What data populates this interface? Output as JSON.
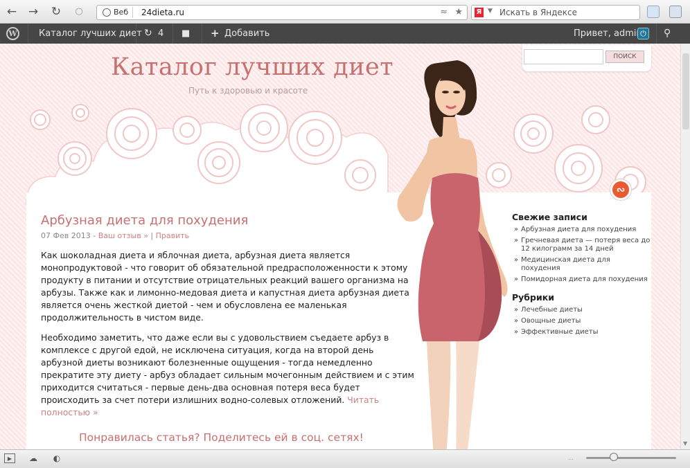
{
  "browser": {
    "site_ident": "Веб",
    "url": "24dieta.ru",
    "search_placeholder": "Искать в Яндексе",
    "yandex_logo": "Я"
  },
  "admin_bar": {
    "site_name": "Каталог лучших диет",
    "updates_count": "4",
    "add_new": "Добавить",
    "greeting": "Привет, admin"
  },
  "header": {
    "title": "Каталог лучших диет",
    "tagline": "Путь к здоровью и красоте",
    "search_button": "ПОИСК"
  },
  "post": {
    "title": "Арбузная диета для похудения",
    "date": "07 Фев 2013",
    "separator1": " - ",
    "reviews_link": "Ваш отзыв »",
    "separator2": " | ",
    "edit_link": "Править",
    "paragraph1": "Как шоколадная диета и яблочная диета, арбузная диета является монопродуктовой - что говорит об обязательной предрасположенности к этому продукту в питании и отсутствие отрицательных реакций вашего организма на арбузы. Также как и лимонно-медовая диета и капустная диета арбузная диета является очень жесткой диетой - чем и обусловлена ее маленькая продолжительность в чистом виде.",
    "paragraph2": "Необходимо заметить, что даже если вы с удовольствием съедаете арбуз в комплексе с другой едой, не исключена ситуация, когда на второй день арбузной диеты возникают болезненные ощущения - тогда немедленно прекратите эту диету - арбуз обладает сильным мочегонным действием и с этим приходится считаться - первые день-два основная потеря веса будет происходить за счет потери излишних водно-солевых отложений.",
    "read_more": "Читать полностью »",
    "share_text": "Понравилась статья? Поделитесь ей в соц. сетях!"
  },
  "sidebar": {
    "recent_heading": "Свежие записи",
    "recent": [
      {
        "label": "Арбузная диета для похудения"
      },
      {
        "label": "Гречневая диета — потеря веса до 12 килограмм за 14 дней"
      },
      {
        "label": "Медицинская диета для похудения"
      },
      {
        "label": "Помидорная диета для похудения"
      }
    ],
    "categories_heading": "Рубрики",
    "categories": [
      {
        "label": "Лечебные диеты"
      },
      {
        "label": "Овощные диеты"
      },
      {
        "label": "Эффективные диеты"
      }
    ]
  },
  "colors": {
    "accent": "#c77070",
    "link": "#d28080",
    "admin_bar": "#464646",
    "rss": "#e95b33"
  },
  "icons": {
    "back": "back-arrow-icon",
    "forward": "forward-arrow-icon",
    "reload": "reload-icon",
    "key": "key-icon",
    "rss_feed": "rss-feed-icon",
    "star": "bookmark-star-icon",
    "wordpress": "wordpress-logo-icon",
    "updates": "updates-icon",
    "comments": "comments-icon",
    "plus": "plus-icon",
    "power": "power-icon",
    "search": "search-icon"
  }
}
